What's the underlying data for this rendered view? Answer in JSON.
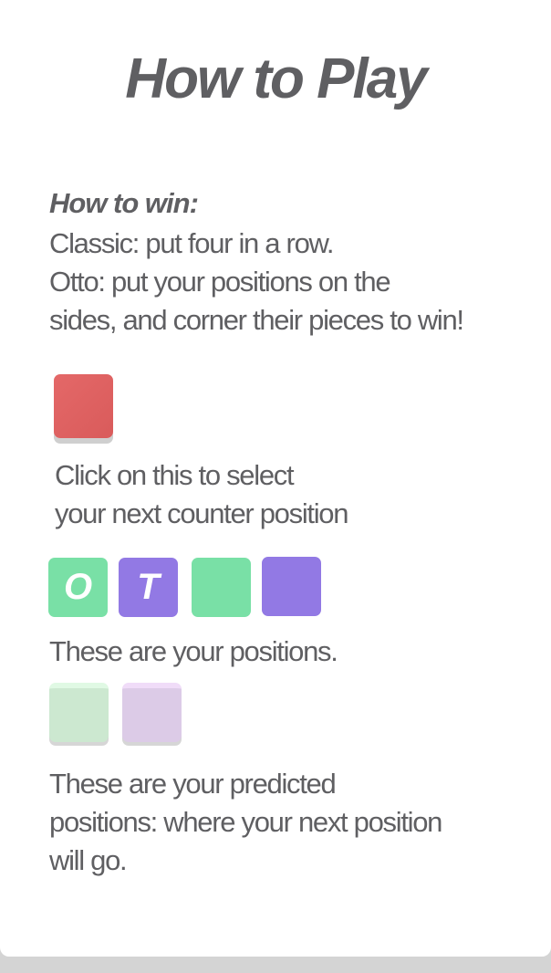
{
  "title": "How to Play",
  "how_to_win": {
    "heading": "How to win:",
    "lines": [
      "Classic: put four in a row.",
      "Otto: put your positions on the",
      "sides, and corner their pieces to win!"
    ]
  },
  "select_counter": {
    "color": "#e06262",
    "caption_lines": [
      "Click on this to select",
      "your next counter position"
    ]
  },
  "positions": {
    "tiles": [
      {
        "label": "O",
        "color": "#79e0a6"
      },
      {
        "label": "T",
        "color": "#9279e4"
      },
      {
        "label": "",
        "color": "#79e0a6"
      },
      {
        "label": "",
        "color": "#9279e4"
      }
    ],
    "caption": "These are your positions."
  },
  "predicted": {
    "tiles": [
      {
        "color": "#cce8d0"
      },
      {
        "color": "#dccbe7"
      }
    ],
    "caption_lines": [
      "These are your predicted",
      "positions: where your next position",
      "will go."
    ]
  }
}
